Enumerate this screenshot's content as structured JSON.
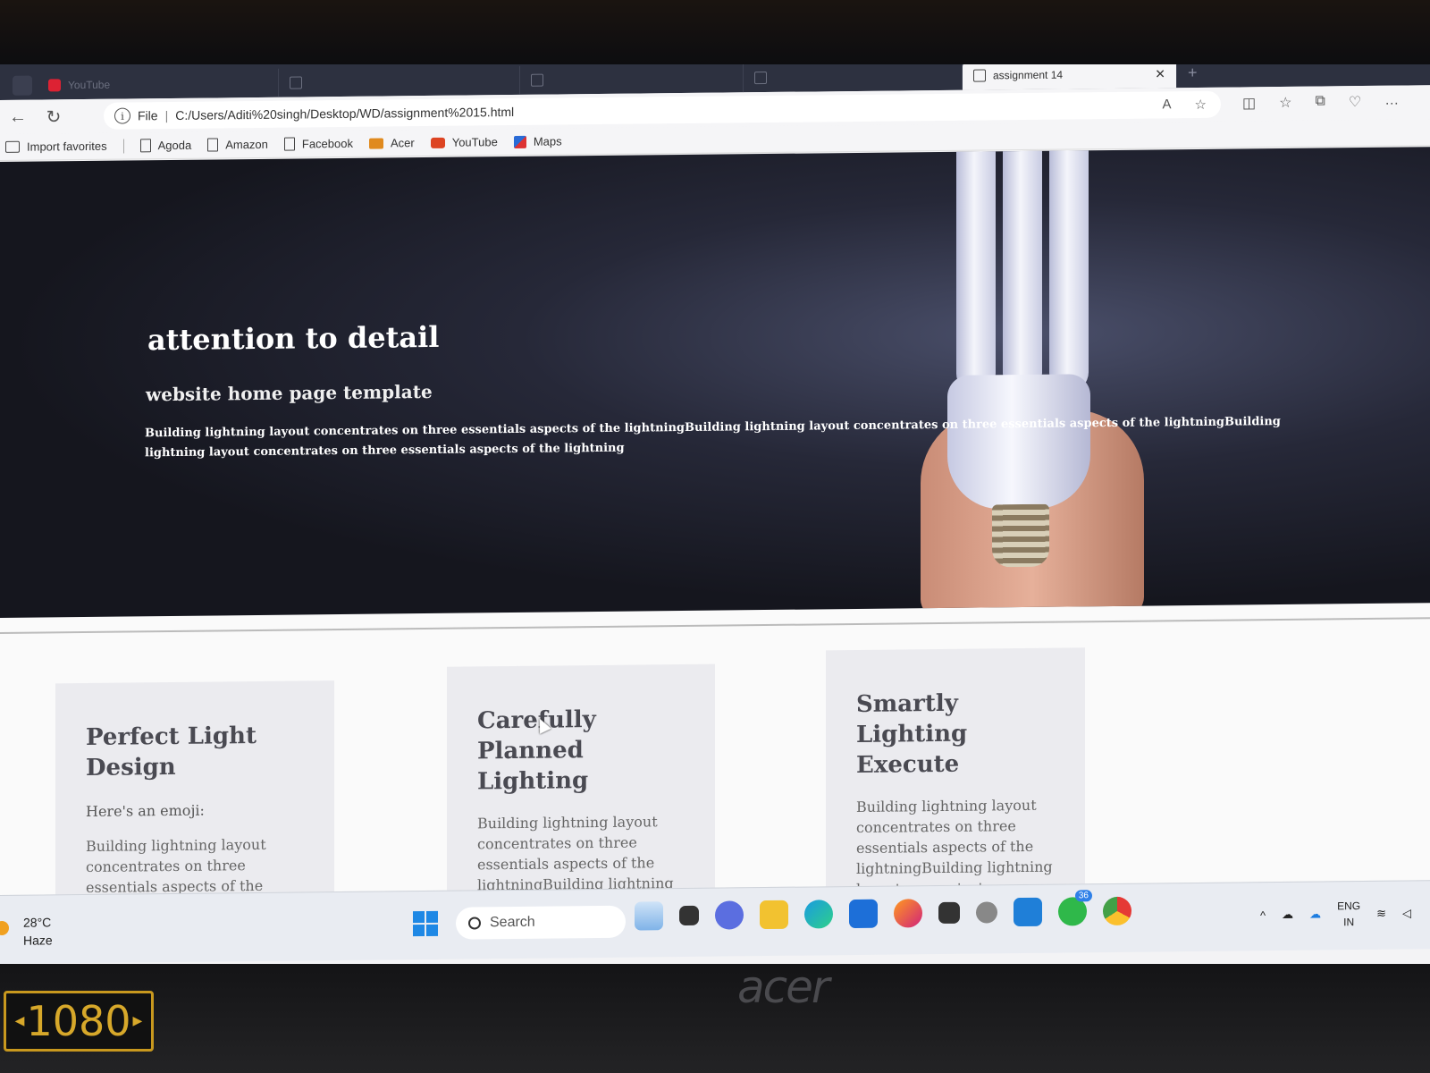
{
  "browser": {
    "tabs": [
      {
        "label": "YouTube",
        "icon": "youtube-icon"
      },
      {
        "label": "",
        "icon": "page-icon"
      },
      {
        "label": "",
        "icon": "page-icon"
      },
      {
        "label": "",
        "icon": "page-icon"
      },
      {
        "label": "assignment 14",
        "icon": "page-icon",
        "active": true
      }
    ],
    "address_scheme": "File",
    "address_url": "C:/Users/Aditi%20singh/Desktop/WD/assignment%2015.html",
    "favorites": [
      {
        "label": "Import favorites",
        "icon": "import-icon"
      },
      {
        "label": "Agoda",
        "icon": "page-icon"
      },
      {
        "label": "Amazon",
        "icon": "page-icon"
      },
      {
        "label": "Facebook",
        "icon": "page-icon"
      },
      {
        "label": "Acer",
        "icon": "folder-icon"
      },
      {
        "label": "YouTube",
        "icon": "youtube-icon"
      },
      {
        "label": "Maps",
        "icon": "maps-icon"
      }
    ]
  },
  "hero": {
    "title": "attention to detail",
    "subtitle": "website home page template",
    "text": "Building lightning layout concentrates on three essentials aspects of the lightningBuilding lightning layout concentrates on three essentials aspects of the lightningBuilding lightning layout concentrates on three essentials aspects of the lightning"
  },
  "cards": [
    {
      "title": "Perfect Light Design",
      "emoji_line": "Here's an emoji:",
      "text": "Building lightning layout concentrates on three essentials aspects of the"
    },
    {
      "title": "Carefully Planned Lighting",
      "text": "Building lightning layout concentrates on three essentials aspects of the lightningBuilding lightning layout concentrates on three"
    },
    {
      "title": "Smartly Lighting Execute",
      "text": "Building lightning layout concentrates on three essentials aspects of the lightningBuilding lightning layout concentrates on three"
    }
  ],
  "taskbar": {
    "weather_temp": "28°C",
    "weather_desc": "Haze",
    "search_placeholder": "Search",
    "whatsapp_badge": "36",
    "lang_top": "ENG",
    "lang_bottom": "IN"
  },
  "device": {
    "brand": "acer",
    "resolution_badge": "1080"
  },
  "colors": {
    "windows_accent": "#1e88e5",
    "tab_strip": "#2d3140",
    "hero_bg": "#15161e"
  }
}
